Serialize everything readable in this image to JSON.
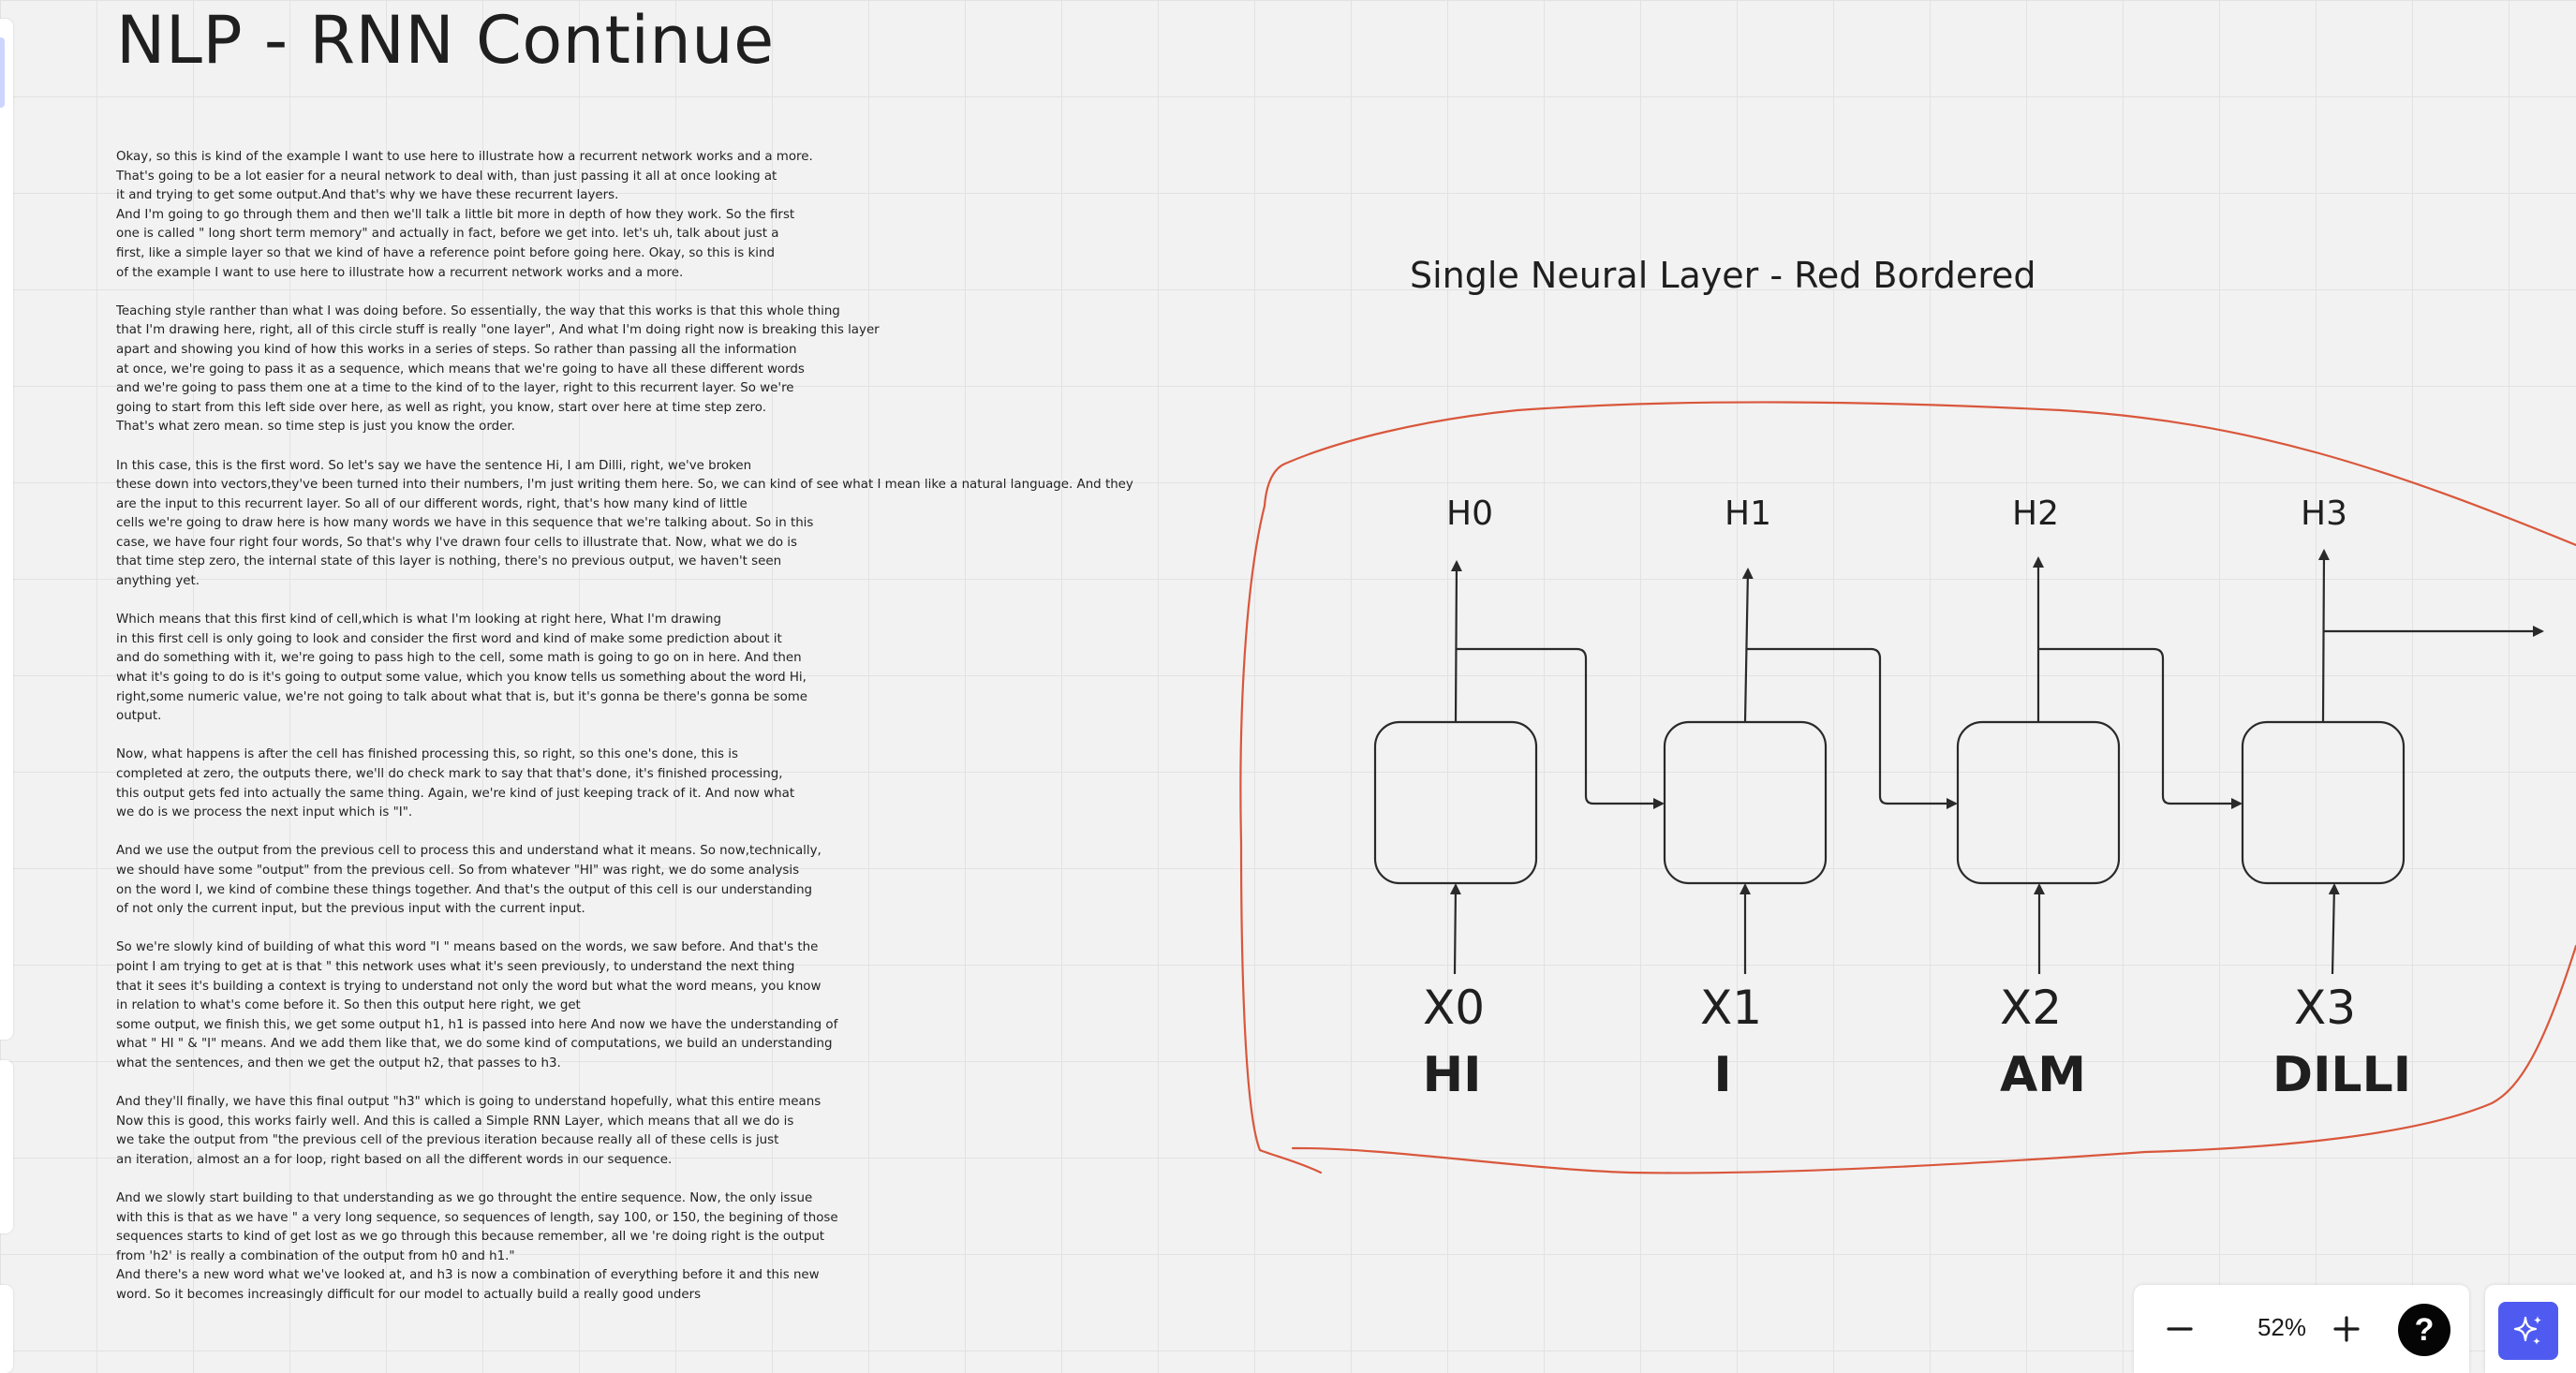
{
  "board": {
    "title": "NLP - RNN Continue"
  },
  "notes": {
    "paragraphs": [
      [
        "Okay, so this is kind of the example I want to use here to illustrate how a recurrent network works and a more.",
        "That's going to be a lot easier for a neural network to deal with, than just passing it all at once looking at",
        "it and trying to get some output.And that's why we have these recurrent layers.",
        "And I'm going to go through them and then we'll talk a little bit more in depth of how they work. So the first",
        "one is called \" long short term memory\" and actually in fact, before we get into. let's uh, talk about just a",
        "first, like a simple layer so that we kind of have a reference point before going here. Okay, so this is kind",
        "of the example I want to use here to illustrate how a recurrent network works and a more."
      ],
      [
        "Teaching style ranther than what I was doing before. So essentially, the way that this works is that this whole thing",
        "that I'm drawing here, right, all of this circle stuff is really \"one layer\", And what I'm doing right now is breaking this layer",
        "apart and showing you kind of how this works in a series of steps. So rather than passing all the information",
        "at once, we're going to pass it as a sequence, which means that we're going to have all these different words",
        "and we're going to pass them one at a time to the kind of to the layer, right to this recurrent layer. So we're",
        "going to start from this left side over here, as well as right, you know, start over here at time step zero.",
        "That's what zero mean. so time step is just you know the order."
      ],
      [
        "In this case, this is the first word. So let's say we have the sentence Hi, I am Dilli, right, we've broken",
        "these down into vectors,they've been turned into their numbers, I'm just writing them here. So, we can kind of see what I mean like a natural language. And they",
        "are the input to this recurrent layer. So all of our different words, right, that's how many kind of little",
        "cells we're going to draw here is how many words we have in this sequence that we're talking about. So in this",
        "case, we have four right four words, So that's why I've drawn four cells to illustrate that. Now, what we do is",
        "that time step zero, the internal state of this layer is nothing, there's no previous output, we haven't seen",
        "anything yet."
      ],
      [
        "Which means that this first kind of cell,which is what I'm looking at right here, What I'm drawing",
        "in this first cell is only going to look and consider the first word and kind of make some prediction about it",
        "and do something with it, we're going to pass high to the cell, some math is going to go on in here. And then",
        "what it's going to do is it's going to output some value, which you know tells us something about the word Hi,",
        "right,some numeric value, we're not going to talk about what that is, but it's gonna be there's gonna be some",
        "output."
      ],
      [
        "Now, what happens is after the cell has finished processing this, so right, so this one's done, this is",
        "completed at zero, the outputs there, we'll do check mark to say that that's done, it's finished processing,",
        "this output gets fed into actually the same thing. Again, we're kind of just keeping track of it. And now what",
        "we do is we process the next input which is \"I\"."
      ],
      [
        "And we use the output from the previous cell to process this and understand what it means. So now,technically,",
        "we should have some \"output\" from the previous cell. So from whatever \"HI\" was right, we do some analysis",
        "on the word I, we kind of combine these things together. And that's the output of this cell is our understanding",
        "of not only the current input, but the previous input with the current input."
      ],
      [
        "So we're slowly kind of building of what this word \"I \" means based on the words, we saw before. And that's the",
        "point I am trying to get at is that \" this network uses what it's seen previously, to understand the next thing",
        "that it sees it's building a context is trying to understand not only the word but what the word means, you know",
        "in relation to what's come before it. So then this output here right, we get",
        "some output, we finish this, we get some output h1, h1 is passed into here And now we have the understanding of",
        "what \" HI \" & \"I\" means. And we add them like that, we do some kind of computations, we build an understanding",
        "what the sentences, and then we get the output h2, that passes to h3."
      ],
      [
        "And they'll finally, we have this final output \"h3\" which is going to understand hopefully, what this entire means",
        "Now this is good, this works fairly well. And this is called  a Simple RNN Layer, which means that all we do is",
        "we take the output from \"the previous cell of the previous iteration because really all of these cells is just",
        "an iteration, almost an a for loop, right based on all the different words in our sequence."
      ],
      [
        "And we slowly start building to that understanding as we go throught the entire sequence. Now, the only issue",
        "with this is that as we have \" a very long sequence, so sequences of length, say 100, or 150, the begining of those",
        "sequences starts to kind of get lost as we go through this because remember, all we 're doing right is the output",
        "from 'h2' is really a combination of the output from h0 and h1.\"",
        "And there's a new word what we've looked at, and h3 is now a combination of everything before it and this new",
        "word. So it becomes increasingly difficult for our model to actually build a really good unders"
      ]
    ]
  },
  "diagram": {
    "title": "Single Neural Layer - Red Bordered",
    "border_color": "#d9573c",
    "stroke_color": "#2a2a2a",
    "cells": [
      {
        "hidden_label": "H0",
        "input_label": "X0",
        "word": "HI"
      },
      {
        "hidden_label": "H1",
        "input_label": "X1",
        "word": "I"
      },
      {
        "hidden_label": "H2",
        "input_label": "X2",
        "word": "AM"
      },
      {
        "hidden_label": "H3",
        "input_label": "X3",
        "word": "DILLI"
      }
    ]
  },
  "zoom_controls": {
    "zoom_level": "52%",
    "help_label": "?",
    "icons": [
      "minus-icon",
      "plus-icon",
      "help-icon",
      "sparkles-icon"
    ],
    "ai_color": "#4f5bf0"
  }
}
